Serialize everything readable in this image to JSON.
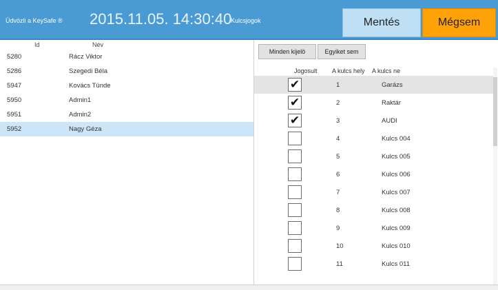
{
  "header": {
    "welcome": "Üdvözli a KeySafe ®",
    "datetime": "2015.11.05. 14:30:40",
    "section_title": "Kulcsjogok",
    "save_label": "Mentés",
    "cancel_label": "Mégsem",
    "colors": {
      "header_bg": "#4a9ad4",
      "save_bg": "#bfe0f4",
      "cancel_bg": "#ffa20a"
    }
  },
  "users": {
    "columns": [
      "Id",
      "Név"
    ],
    "rows": [
      {
        "id": "5280",
        "name": "Rácz Viktor"
      },
      {
        "id": "5286",
        "name": "Szegedi Béla"
      },
      {
        "id": "5947",
        "name": "Kovács Tünde"
      },
      {
        "id": "5950",
        "name": "Admin1"
      },
      {
        "id": "5951",
        "name": "Admin2"
      },
      {
        "id": "5952",
        "name": "Nagy Géza"
      }
    ],
    "selected_index": 5
  },
  "rights": {
    "select_all_label": "Minden kijelö",
    "select_none_label": "Egyiket sem",
    "columns": [
      "Jogosult",
      "A kulcs hely",
      "A kulcs ne"
    ],
    "rows": [
      {
        "checked": true,
        "num": "1",
        "name": "Garázs"
      },
      {
        "checked": true,
        "num": "2",
        "name": "Raktár"
      },
      {
        "checked": true,
        "num": "3",
        "name": "AUDI"
      },
      {
        "checked": false,
        "num": "4",
        "name": "Kulcs 004"
      },
      {
        "checked": false,
        "num": "5",
        "name": "Kulcs 005"
      },
      {
        "checked": false,
        "num": "6",
        "name": "Kulcs 006"
      },
      {
        "checked": false,
        "num": "7",
        "name": "Kulcs 007"
      },
      {
        "checked": false,
        "num": "8",
        "name": "Kulcs 008"
      },
      {
        "checked": false,
        "num": "9",
        "name": "Kulcs 009"
      },
      {
        "checked": false,
        "num": "10",
        "name": "Kulcs 010"
      },
      {
        "checked": false,
        "num": "11",
        "name": "Kulcs 011"
      }
    ],
    "selected_index": 0,
    "check_glyph": "✔"
  }
}
